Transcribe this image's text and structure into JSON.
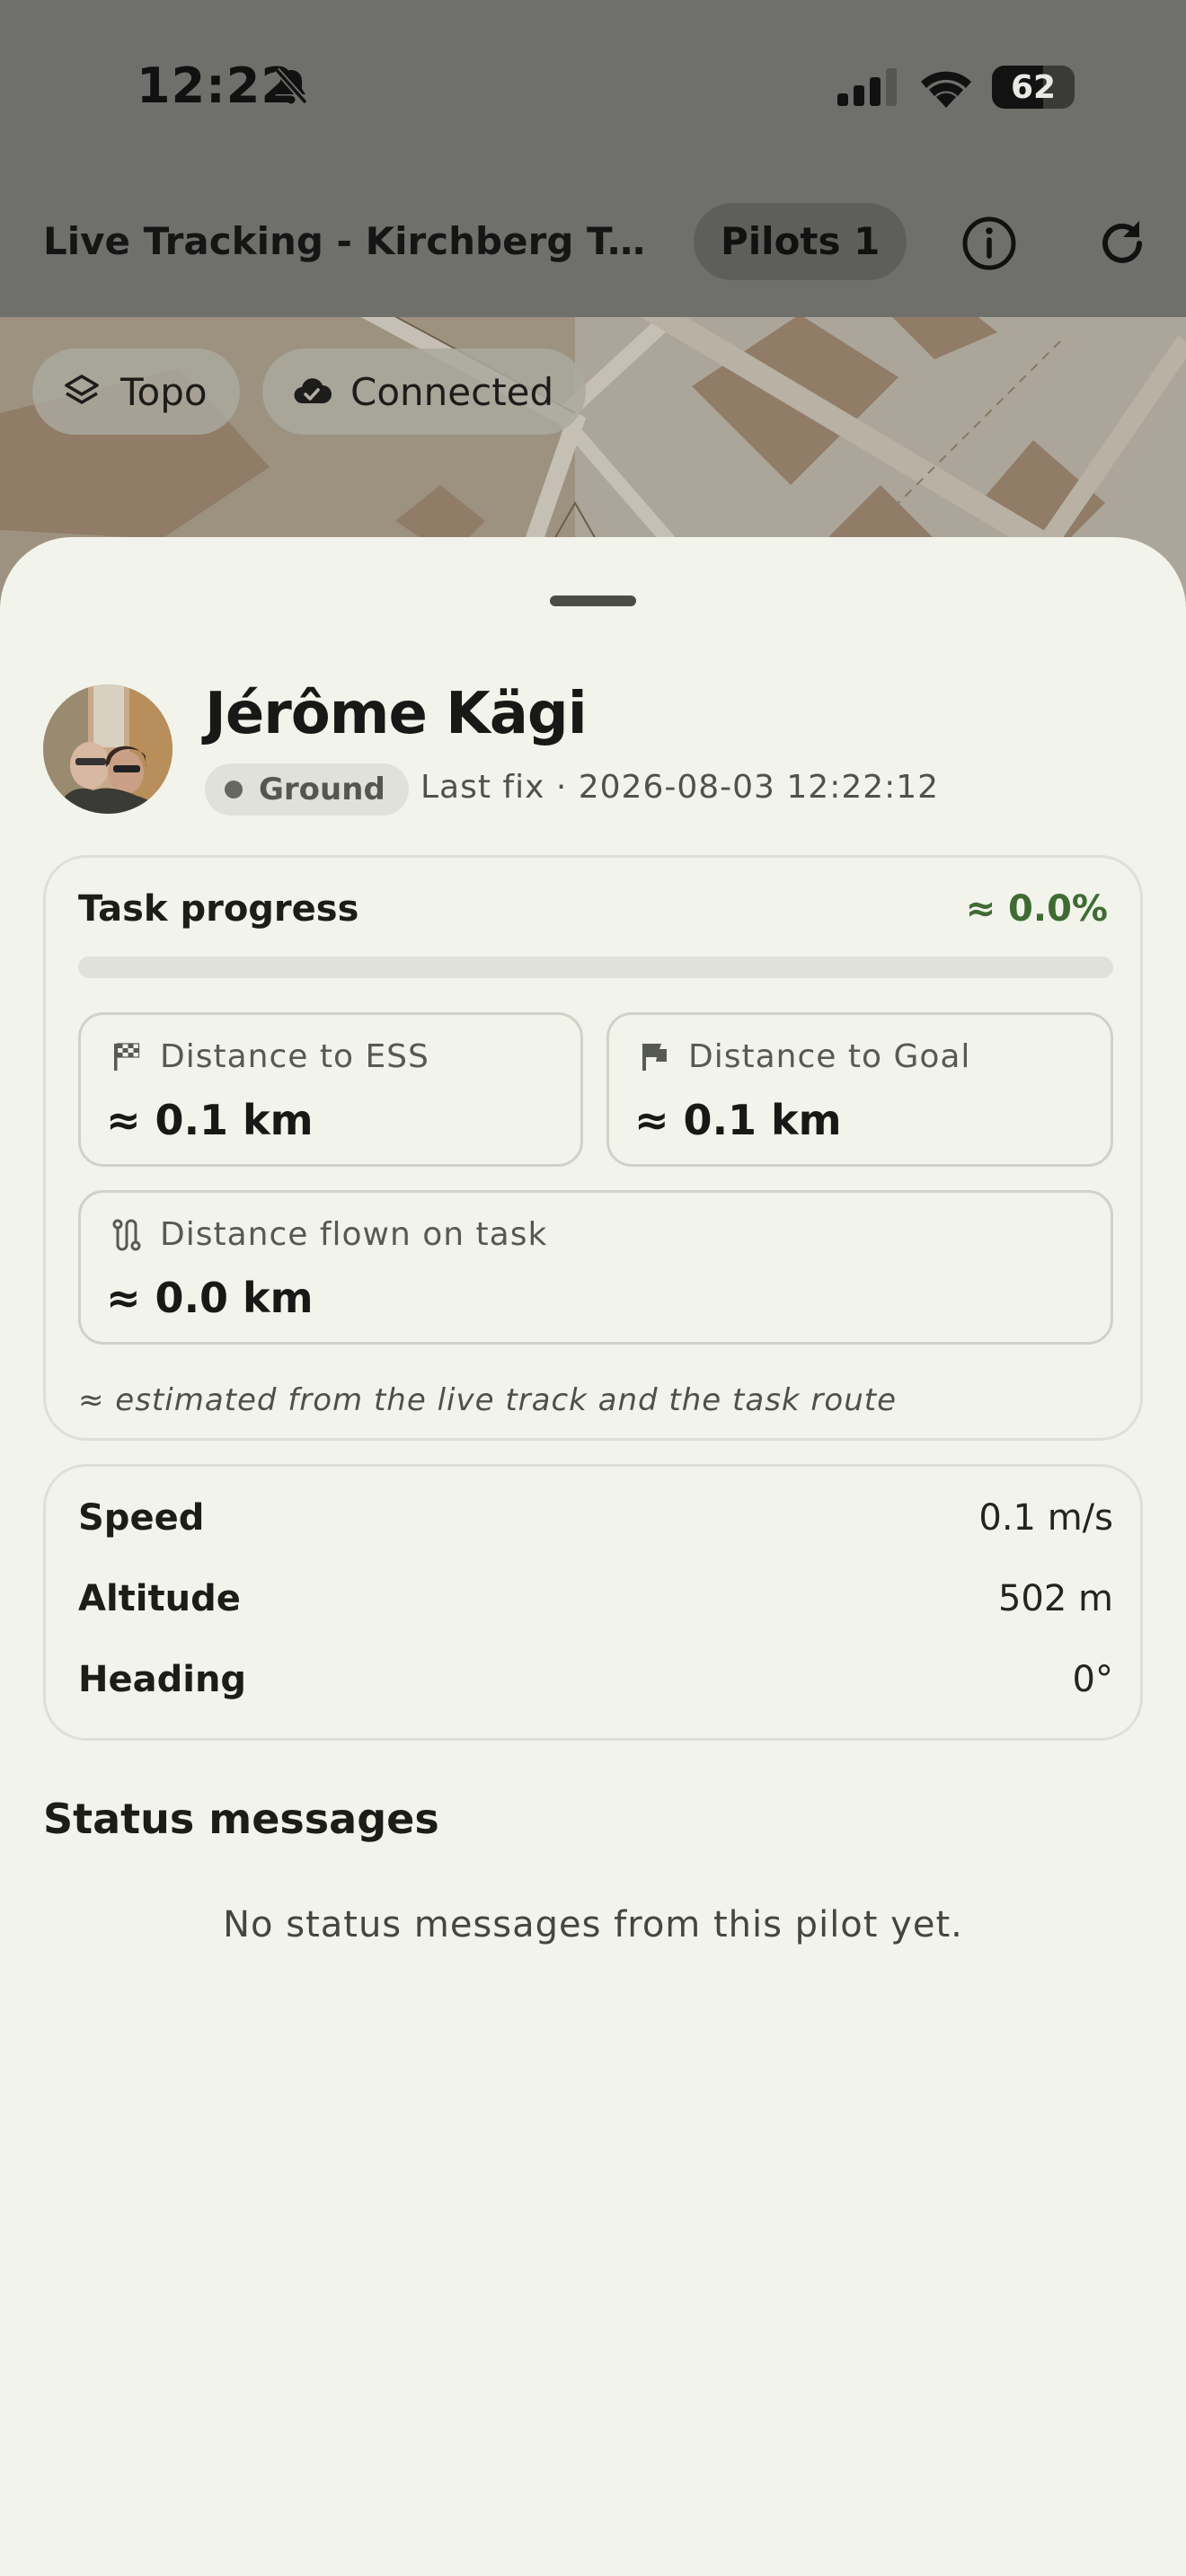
{
  "status_bar": {
    "time": "12:22",
    "battery_percent": "62",
    "battery_level": 0.62
  },
  "header": {
    "title": "Live Tracking - Kirchberg Test ...",
    "pilots_label": "Pilots 1"
  },
  "map": {
    "layer_chip": "Topo",
    "connection_chip": "Connected"
  },
  "pilot": {
    "name": "Jérôme Kägi",
    "status": "Ground",
    "last_fix": "Last fix · 2026-08-03 12:22:12"
  },
  "task": {
    "title": "Task progress",
    "percent": "≈ 0.0%",
    "progress_fraction": 0.0,
    "ess_label": "Distance to ESS",
    "ess_value": "≈ 0.1 km",
    "goal_label": "Distance to Goal",
    "goal_value": "≈ 0.1 km",
    "flown_label": "Distance flown on task",
    "flown_value": "≈ 0.0 km",
    "note": "≈ estimated from the live track and the task route"
  },
  "telemetry": {
    "speed_label": "Speed",
    "speed_value": "0.1 m/s",
    "altitude_label": "Altitude",
    "altitude_value": "502 m",
    "heading_label": "Heading",
    "heading_value": "0°"
  },
  "status_messages": {
    "heading": "Status messages",
    "empty_text": "No status messages from this pilot yet."
  },
  "colors": {
    "accent": "#3f6b33",
    "background": "#f2f4ec"
  },
  "icons": [
    "bell-slash-icon",
    "signal-icon",
    "wifi-icon",
    "battery-icon",
    "info-icon",
    "refresh-icon",
    "layers-icon",
    "cloud-check-icon",
    "checkered-flag-icon",
    "flag-icon",
    "route-icon"
  ]
}
